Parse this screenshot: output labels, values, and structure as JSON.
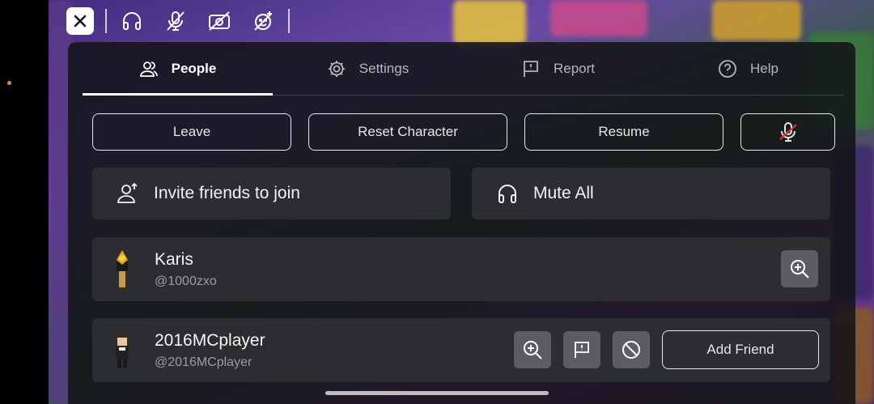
{
  "topbar": {
    "icons": [
      "close-icon",
      "headphones-icon",
      "mic-muted-icon",
      "camera-off-icon",
      "gesture-off-icon"
    ]
  },
  "tabs": [
    {
      "label": "People",
      "icon": "people-icon",
      "active": true
    },
    {
      "label": "Settings",
      "icon": "gear-icon",
      "active": false
    },
    {
      "label": "Report",
      "icon": "report-flag-icon",
      "active": false
    },
    {
      "label": "Help",
      "icon": "help-icon",
      "active": false
    }
  ],
  "actions": {
    "leave": "Leave",
    "reset": "Reset Character",
    "resume": "Resume",
    "mic_icon": "mic-muted-icon"
  },
  "big_buttons": {
    "invite": "Invite friends to join",
    "mute_all": "Mute All"
  },
  "players": [
    {
      "name": "Karis",
      "username": "@1000zxo",
      "actions": [
        "inspect"
      ]
    },
    {
      "name": "2016MCplayer",
      "username": "@2016MCplayer",
      "actions": [
        "inspect",
        "report",
        "block"
      ],
      "add_friend": "Add Friend"
    }
  ],
  "colors": {
    "panel": "#121316",
    "row": "#2c2d31",
    "square_button": "#5b5d62",
    "muted_red": "#d9363e"
  }
}
